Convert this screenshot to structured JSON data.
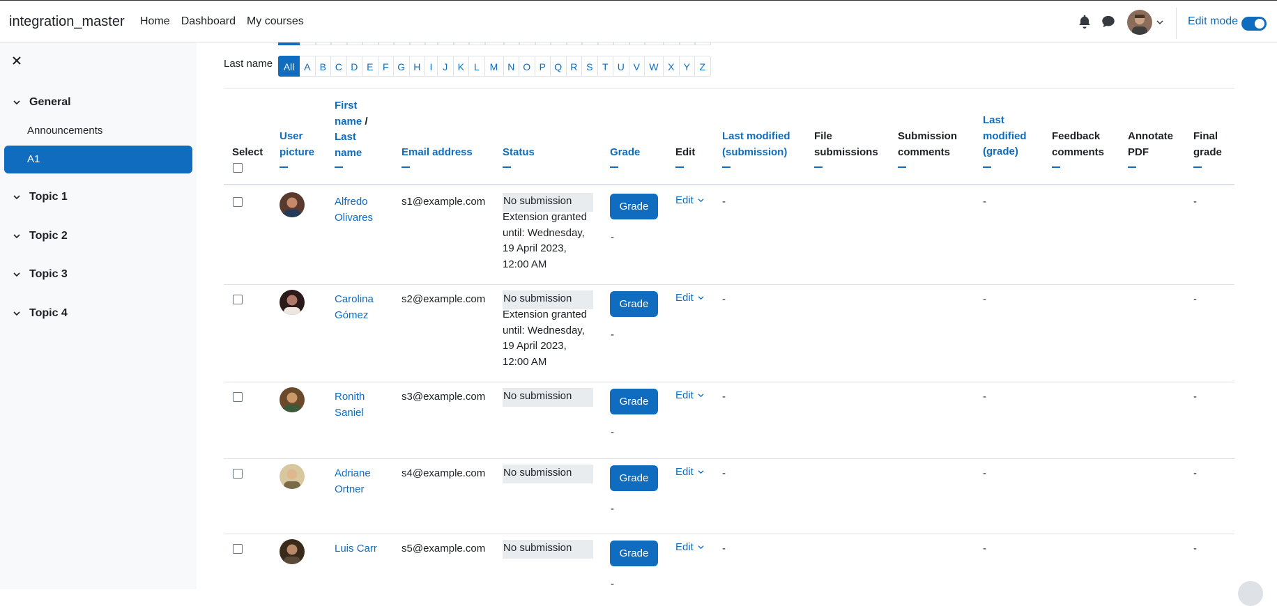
{
  "navbar": {
    "brand": "integration_master",
    "links": [
      "Home",
      "Dashboard",
      "My courses"
    ],
    "edit_mode_label": "Edit mode",
    "edit_mode_on": true
  },
  "drawer": {
    "sections": [
      {
        "label": "General",
        "items": [
          "Announcements",
          "A1"
        ],
        "active_item": "A1"
      },
      {
        "label": "Topic 1"
      },
      {
        "label": "Topic 2"
      },
      {
        "label": "Topic 3"
      },
      {
        "label": "Topic 4"
      }
    ]
  },
  "filters": {
    "last_name_label": "Last name",
    "letters": [
      "All",
      "A",
      "B",
      "C",
      "D",
      "E",
      "F",
      "G",
      "H",
      "I",
      "J",
      "K",
      "L",
      "M",
      "N",
      "O",
      "P",
      "Q",
      "R",
      "S",
      "T",
      "U",
      "V",
      "W",
      "X",
      "Y",
      "Z"
    ],
    "selected": "All"
  },
  "table": {
    "headers": {
      "select": "Select",
      "user_picture": "User picture",
      "first_name": "First name",
      "slash": " /",
      "last_name": "Last name",
      "email": "Email address",
      "status": "Status",
      "grade": "Grade",
      "edit": "Edit",
      "last_modified_submission": "Last modified (submission)",
      "file_submissions": "File submissions",
      "submission_comments": "Submission comments",
      "last_modified_grade": "Last modified (grade)",
      "feedback_comments": "Feedback comments",
      "annotate_pdf": "Annotate PDF",
      "final_grade": "Final grade"
    },
    "grade_button_label": "Grade",
    "edit_label": "Edit",
    "rows": [
      {
        "first": "Alfredo",
        "last": "Olivares",
        "email": "s1@example.com",
        "status": "No submission",
        "extension": "Extension granted until: Wednesday, 19 April 2023, 12:00 AM",
        "grade_value": "-",
        "last_modified_submission": "-",
        "last_modified_grade": "-",
        "final_grade": "-"
      },
      {
        "first": "Carolina",
        "last": "Gómez",
        "email": "s2@example.com",
        "status": "No submission",
        "extension": "Extension granted until: Wednesday, 19 April 2023, 12:00 AM",
        "grade_value": "-",
        "last_modified_submission": "-",
        "last_modified_grade": "-",
        "final_grade": "-"
      },
      {
        "first": "Ronith",
        "last": "Saniel",
        "email": "s3@example.com",
        "status": "No submission",
        "extension": "",
        "grade_value": "-",
        "last_modified_submission": "-",
        "last_modified_grade": "-",
        "final_grade": "-"
      },
      {
        "first": "Adriane",
        "last": "Ortner",
        "email": "s4@example.com",
        "status": "No submission",
        "extension": "",
        "grade_value": "-",
        "last_modified_submission": "-",
        "last_modified_grade": "-",
        "final_grade": "-"
      },
      {
        "first": "Luis",
        "last": "Carr",
        "email": "s5@example.com",
        "status": "No submission",
        "extension": "",
        "grade_value": "-",
        "last_modified_submission": "-",
        "last_modified_grade": "-",
        "final_grade": "-"
      }
    ]
  },
  "colors": {
    "accent": "#0f6cbf",
    "drawer_bg": "#f8f9fa",
    "status_bg": "#e9ecef"
  }
}
